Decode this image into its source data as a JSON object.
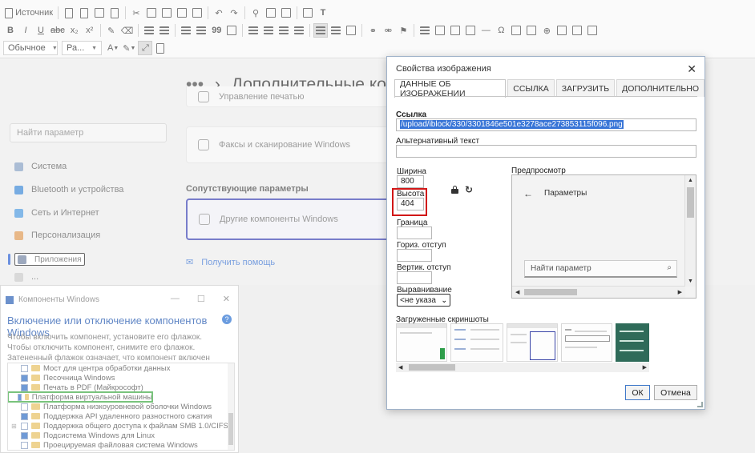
{
  "toolbar": {
    "source_label": "Источник",
    "format_label": "Обычное",
    "font_label": "Ра...",
    "bold": "B",
    "italic": "I",
    "underline": "U",
    "strike": "abc",
    "sub": "x₂",
    "sup": "x²",
    "blockquote": "99",
    "text_t": "T",
    "text_color": "A",
    "special_char": "Ω"
  },
  "background": {
    "settings": {
      "header_dots": "•••",
      "header_chevron": "›",
      "header": "Дополнительные комп",
      "search_placeholder": "Найти параметр",
      "sidebar": [
        {
          "label": "Система",
          "color": "#8fa7c7"
        },
        {
          "label": "Bluetooth и устройства",
          "color": "#4a90d9"
        },
        {
          "label": "Сеть и Интернет",
          "color": "#5aa0e0"
        },
        {
          "label": "Персонализация",
          "color": "#e0a060"
        },
        {
          "label": "Приложения",
          "color": "#7c8ca8"
        },
        {
          "label": "...",
          "color": "#cccccc"
        }
      ],
      "card_top": "Управление печатью",
      "card_fax": "Факсы и сканирование Windows",
      "related_heading": "Сопутствующие параметры",
      "card_other": "Другие компоненты Windows",
      "help_link": "Получить помощь"
    },
    "features_window": {
      "title": "Компоненты Windows",
      "controls": [
        "—",
        "☐",
        "✕"
      ],
      "heading": "Включение или отключение компонентов Windows",
      "info": "?",
      "description": "Чтобы включить компонент, установите его флажок. Чтобы отключить компонент, снимите его флажок. Затененный флажок означает, что компонент включен частично.",
      "items": [
        {
          "label": "Мост для центра обработки данных",
          "state": "off",
          "expand": ""
        },
        {
          "label": "Песочница Windows",
          "state": "on",
          "expand": ""
        },
        {
          "label": "Печать в PDF (Майкрософт)",
          "state": "on",
          "expand": ""
        },
        {
          "label": "Платформа виртуальной машины",
          "state": "on",
          "expand": "",
          "marked": true
        },
        {
          "label": "Платформа низкоуровневой оболочки Windows",
          "state": "off",
          "expand": ""
        },
        {
          "label": "Поддержка API удаленного разностного сжатия",
          "state": "on",
          "expand": ""
        },
        {
          "label": "Поддержка общего доступа к файлам SMB 1.0/CIFS",
          "state": "off",
          "expand": "⊞"
        },
        {
          "label": "Подсистема Windows для Linux",
          "state": "on",
          "expand": ""
        },
        {
          "label": "Проецируемая файловая система Windows",
          "state": "off",
          "expand": ""
        }
      ]
    }
  },
  "dialog": {
    "title": "Свойства изображения",
    "close": "✕",
    "tabs": [
      "ДАННЫЕ ОБ ИЗОБРАЖЕНИИ",
      "ССЫЛКА",
      "ЗАГРУЗИТЬ",
      "ДОПОЛНИТЕЛЬНО"
    ],
    "url_label": "Ссылка",
    "url_value": "/upload/iblock/330/3301846e501e3278ace273853115f096.png",
    "alt_label": "Альтернативный текст",
    "alt_value": "",
    "width_label": "Ширина",
    "width_value": "800",
    "height_label": "Высота",
    "height_value": "404",
    "border_label": "Граница",
    "border_value": "",
    "hspace_label": "Гориз. отступ",
    "hspace_value": "",
    "vspace_label": "Вертик. отступ",
    "vspace_value": "",
    "align_label": "Выравнивание",
    "align_value": "<не указа",
    "reset_glyph": "↻",
    "preview_label": "Предпросмотр",
    "preview": {
      "back": "←",
      "title": "Параметры",
      "search": "Найти параметр",
      "search_icon": "⌕"
    },
    "screenshots_label": "Загруженные скриншоты",
    "ok": "ОК",
    "cancel": "Отмена"
  }
}
